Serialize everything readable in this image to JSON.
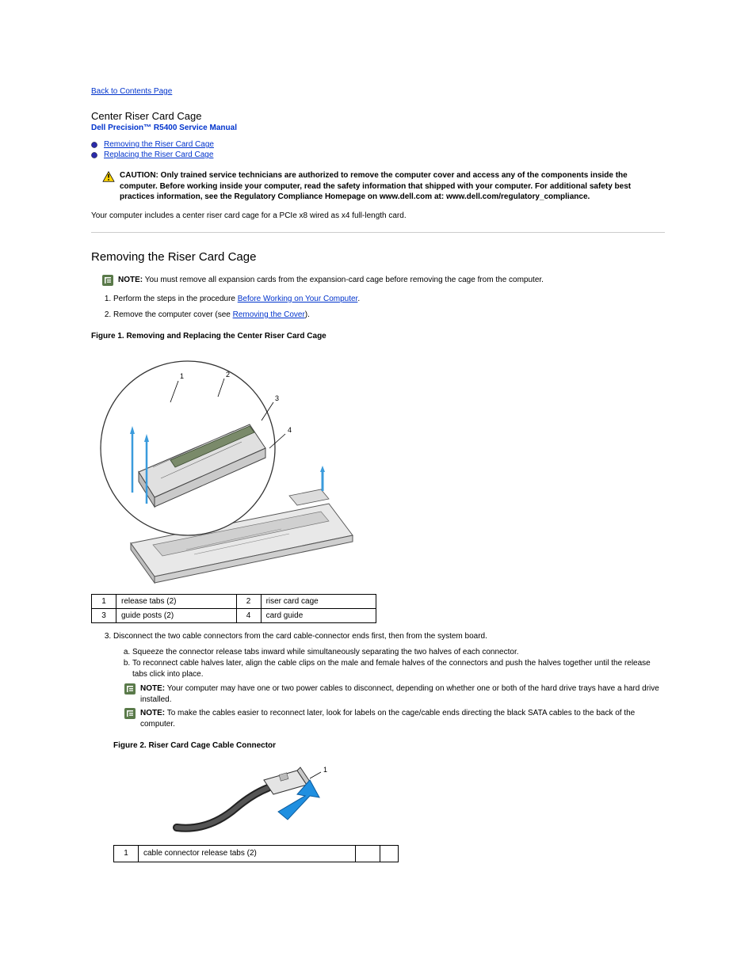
{
  "back_link": "Back to Contents Page",
  "page_title": "Center Riser Card Cage",
  "manual_title": "Dell Precision™ R5400 Service Manual",
  "toc": {
    "items": [
      {
        "label": "Removing the Riser Card Cage"
      },
      {
        "label": "Replacing the Riser Card Cage"
      }
    ]
  },
  "caution": {
    "bold": "CAUTION: Only trained service technicians are authorized to remove the computer cover and access any of the components inside the computer. Before working inside your computer, read the safety information that shipped with your computer. For additional safety best practices information, see the Regulatory Compliance Homepage on www.dell.com at: www.dell.com/regulatory_compliance.",
    "text": ""
  },
  "intro_para": "Your computer includes a center riser card cage for a PCIe x8 wired as x4 full-length card.",
  "section_remove": {
    "heading": "Removing the Riser Card Cage",
    "note1": {
      "bold": "NOTE:",
      "text": " You must remove all expansion cards from the expansion-card cage before removing the cage from the computer."
    },
    "steps": [
      {
        "pre": "Perform the steps in the procedure ",
        "link": "Before Working on Your Computer",
        "post": "."
      },
      {
        "pre": "Remove the computer cover (see ",
        "link": "Removing the Cover",
        "post": ")."
      }
    ],
    "figure1_caption": "Figure 1. Removing and Replacing the Center Riser Card Cage",
    "legend1": [
      {
        "num": "1",
        "label": "release tabs (2)"
      },
      {
        "num": "2",
        "label": "riser card cage"
      },
      {
        "num": "3",
        "label": "guide posts (2)"
      },
      {
        "num": "4",
        "label": "card guide"
      }
    ],
    "step3": "Disconnect the two cable connectors from the card cable-connector ends first, then from the system board.",
    "substeps3": [
      "Squeeze the connector release tabs inward while simultaneously separating the two halves of each connector.",
      "To reconnect cable halves later, align the cable clips on the male and female halves of the connectors and push the halves together until the release tabs click into place."
    ],
    "note2": {
      "bold": "NOTE:",
      "text": " Your computer may have one or two power cables to disconnect, depending on whether one or both of the hard drive trays have a hard drive installed."
    },
    "note3": {
      "bold": "NOTE:",
      "text": " To make the cables easier to reconnect later, look for labels on the cage/cable ends directing the black SATA cables to the back of the computer."
    },
    "figure2_caption": "Figure 2. Riser Card Cage Cable Connector",
    "legend2": [
      {
        "num": "1",
        "label": "cable connector release tabs (2)"
      }
    ]
  }
}
